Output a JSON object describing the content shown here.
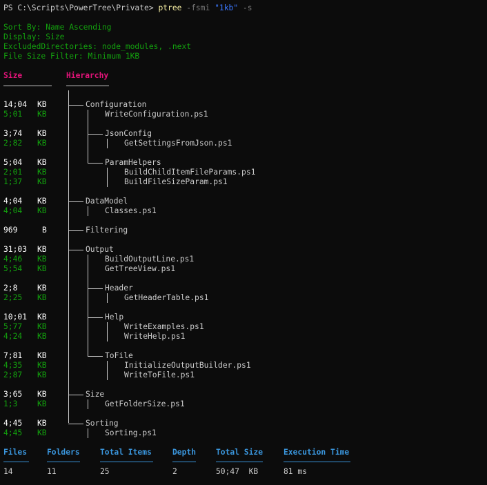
{
  "prompt": {
    "path": "PS C:\\Scripts\\PowerTree\\Private> ",
    "command": "ptree",
    "param1": "-fsmi",
    "arg1": "\"1kb\"",
    "param2": "-s"
  },
  "settings": [
    "Sort By: Name Ascending",
    "Display: Size",
    "ExcludedDirectories: node_modules, .next",
    "File Size Filter: Minimum 1KB"
  ],
  "headers": {
    "size": "Size",
    "hierarchy": "Hierarchy"
  },
  "rows": [
    {
      "size": "14;04",
      "unit": "KB",
      "name": "Configuration",
      "kind": "folder"
    },
    {
      "size": "5;01",
      "unit": "KB",
      "name": "WriteConfiguration.ps1",
      "kind": "file"
    },
    {
      "size": "3;74",
      "unit": "KB",
      "name": "JsonConfig",
      "kind": "folder"
    },
    {
      "size": "2;82",
      "unit": "KB",
      "name": "GetSettingsFromJson.ps1",
      "kind": "file"
    },
    {
      "size": "5;04",
      "unit": "KB",
      "name": "ParamHelpers",
      "kind": "folder"
    },
    {
      "size": "2;01",
      "unit": "KB",
      "name": "BuildChildItemFileParams.ps1",
      "kind": "file"
    },
    {
      "size": "1;37",
      "unit": "KB",
      "name": "BuildFileSizeParam.ps1",
      "kind": "file"
    },
    {
      "size": "4;04",
      "unit": "KB",
      "name": "DataModel",
      "kind": "folder"
    },
    {
      "size": "4;04",
      "unit": "KB",
      "name": "Classes.ps1",
      "kind": "file"
    },
    {
      "size": "969",
      "unit": "B",
      "name": "Filtering",
      "kind": "folder"
    },
    {
      "size": "31;03",
      "unit": "KB",
      "name": "Output",
      "kind": "folder"
    },
    {
      "size": "4;46",
      "unit": "KB",
      "name": "BuildOutputLine.ps1",
      "kind": "file"
    },
    {
      "size": "5;54",
      "unit": "KB",
      "name": "GetTreeView.ps1",
      "kind": "file"
    },
    {
      "size": "2;8",
      "unit": "KB",
      "name": "Header",
      "kind": "folder"
    },
    {
      "size": "2;25",
      "unit": "KB",
      "name": "GetHeaderTable.ps1",
      "kind": "file"
    },
    {
      "size": "10;01",
      "unit": "KB",
      "name": "Help",
      "kind": "folder"
    },
    {
      "size": "5;77",
      "unit": "KB",
      "name": "WriteExamples.ps1",
      "kind": "file"
    },
    {
      "size": "4;24",
      "unit": "KB",
      "name": "WriteHelp.ps1",
      "kind": "file"
    },
    {
      "size": "7;81",
      "unit": "KB",
      "name": "ToFile",
      "kind": "folder"
    },
    {
      "size": "4;35",
      "unit": "KB",
      "name": "InitializeOutputBuilder.ps1",
      "kind": "file"
    },
    {
      "size": "2;87",
      "unit": "KB",
      "name": "WriteToFile.ps1",
      "kind": "file"
    },
    {
      "size": "3;65",
      "unit": "KB",
      "name": "Size",
      "kind": "folder"
    },
    {
      "size": "1;3",
      "unit": "KB",
      "name": "GetFolderSize.ps1",
      "kind": "file"
    },
    {
      "size": "4;45",
      "unit": "KB",
      "name": "Sorting",
      "kind": "folder"
    },
    {
      "size": "4;45",
      "unit": "KB",
      "name": "Sorting.ps1",
      "kind": "file"
    }
  ],
  "summary": {
    "headers": [
      "Files",
      "Folders",
      "Total Items",
      "Depth",
      "Total Size",
      "Execution Time"
    ],
    "values": [
      "14",
      "11",
      "25",
      "2",
      "50;47  KB",
      "81 ms"
    ]
  },
  "colors": {
    "background": "#0c0c0c",
    "settings": "#13a10e",
    "header_accent": "#e5137a",
    "summary_header": "#3a96dd",
    "command": "#f9f1a5",
    "string": "#3b78ff"
  }
}
